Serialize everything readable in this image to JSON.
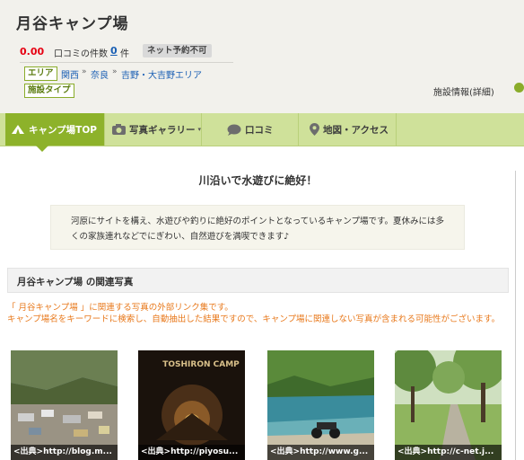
{
  "header": {
    "title": "月谷キャンプ場",
    "score": "0.00",
    "review_label": "口コミの件数",
    "review_count": "0",
    "review_unit": "件",
    "net_badge": "ネット予約不可",
    "area_tag": "エリア",
    "breadcrumb": [
      "関西",
      "奈良",
      "吉野・大吉野エリア"
    ],
    "type_tag": "施設タイプ",
    "facility_link": "施設情報(詳細)"
  },
  "nav": {
    "items": [
      {
        "label": "キャンプ場TOP",
        "icon": "tent-icon"
      },
      {
        "label": "写真ギャラリー",
        "icon": "camera-icon"
      },
      {
        "label": "口コミ",
        "icon": "speech-bubble-icon"
      },
      {
        "label": "地図・アクセス",
        "icon": "map-pin-icon"
      }
    ]
  },
  "main": {
    "headline": "川沿いで水遊びに絶好！",
    "description": "河原にサイトを構え、水遊びや釣りに絶好のポイントとなっているキャンプ場です。夏休みには多くの家族連れなどでにぎわい、自然遊びを満喫できます♪",
    "photos_section_title": "月谷キャンプ場 の関連写真",
    "notice_line1": "「 月谷キャンプ場 」に関連する写真の外部リンク集です。",
    "notice_line2": "キャンプ場名をキーワードに検索し、自動抽出した結果ですので、キャンプ場に関連しない写真が含まれる可能性がございます。",
    "photos": [
      {
        "caption": "<出典>http://blog.m..."
      },
      {
        "caption": "<出典>http://piyosu..."
      },
      {
        "caption": "<出典>http://www.g..."
      },
      {
        "caption": "<出典>http://c-net.j..."
      }
    ],
    "photo2_overlay": "TOSHIRON CAMP"
  },
  "colors": {
    "accent_green": "#8db22a",
    "nav_bg": "#cfe19a",
    "score_red": "#e60012",
    "notice_orange": "#e8791c",
    "link_blue": "#1a5fb4"
  }
}
